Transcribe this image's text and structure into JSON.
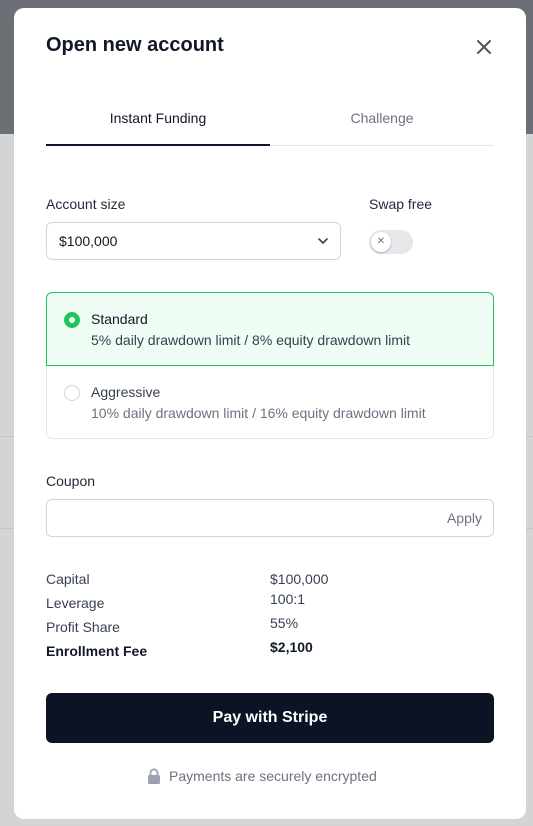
{
  "modal": {
    "title": "Open new account",
    "tabs": [
      {
        "label": "Instant Funding",
        "active": true
      },
      {
        "label": "Challenge",
        "active": false
      }
    ],
    "account_size": {
      "label": "Account size",
      "value": "$100,000"
    },
    "swap_free": {
      "label": "Swap free",
      "enabled": false
    },
    "plans": [
      {
        "name": "Standard",
        "description": "5% daily drawdown limit / 8% equity drawdown limit",
        "selected": true
      },
      {
        "name": "Aggressive",
        "description": "10% daily drawdown limit / 16% equity drawdown limit",
        "selected": false
      }
    ],
    "coupon": {
      "label": "Coupon",
      "value": "",
      "apply_label": "Apply"
    },
    "summary": [
      {
        "label": "Capital",
        "value": "$100,000"
      },
      {
        "label": "Leverage",
        "value": "100:1"
      },
      {
        "label": "Profit Share",
        "value": "55%"
      },
      {
        "label": "Enrollment Fee",
        "value": "$2,100"
      }
    ],
    "pay_button": "Pay with Stripe",
    "secure_note": "Payments are securely encrypted"
  },
  "colors": {
    "accent_green": "#22c55e",
    "primary_button": "#0b1324"
  },
  "icons": [
    "close-icon",
    "chevron-down-icon",
    "x-icon",
    "lock-icon"
  ]
}
